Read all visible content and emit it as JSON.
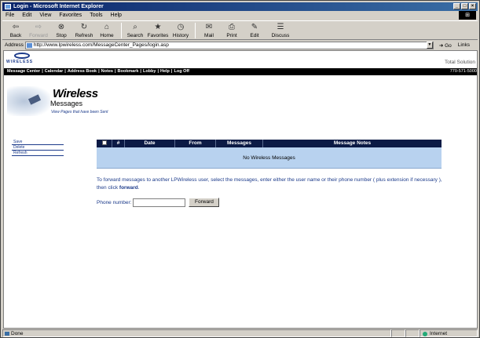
{
  "window": {
    "title": "Login - Microsoft Internet Explorer",
    "controls": [
      "_",
      "□",
      "×"
    ]
  },
  "menubar": {
    "items": [
      "File",
      "Edit",
      "View",
      "Favorites",
      "Tools",
      "Help"
    ]
  },
  "toolbar": {
    "back": "Back",
    "forward": "Forward",
    "stop": "Stop",
    "refresh": "Refresh",
    "home": "Home",
    "search": "Search",
    "favorites": "Favorites",
    "history": "History",
    "mail": "Mail",
    "print": "Print",
    "edit": "Edit",
    "discuss": "Discuss"
  },
  "address": {
    "label": "Address",
    "url": "http://www.lpwireless.com/MessageCenter_Pages/login.asp",
    "go": "Go",
    "links": "Links"
  },
  "site": {
    "logo_text": "WIRELESS",
    "total_solution": "Total Solution",
    "phone": "770-571-5000",
    "nav": [
      "Message Center",
      "Calendar",
      "Address Book",
      "Notes",
      "Bookmark",
      "Lobby",
      "Help",
      "Log Off"
    ]
  },
  "header": {
    "title": "Wireless",
    "subtitle": "Messages",
    "tagline": "View Pages that have been Sent"
  },
  "sidebar": {
    "links": [
      "Save",
      "Delete",
      "Refresh"
    ]
  },
  "table": {
    "columns": [
      "#",
      "Date",
      "From",
      "Messages",
      "Message Notes"
    ],
    "empty_text": "No Wireless Messages"
  },
  "instructions": {
    "text": "To forward messages to another LPWireless user, select the messages, enter either the user name or their phone number ( plus extension if necessary ), then click ",
    "bold": "forward",
    "end": "."
  },
  "forward_form": {
    "label": "Phone number:",
    "button": "Forward"
  },
  "statusbar": {
    "status": "Done",
    "zone": "Internet"
  }
}
